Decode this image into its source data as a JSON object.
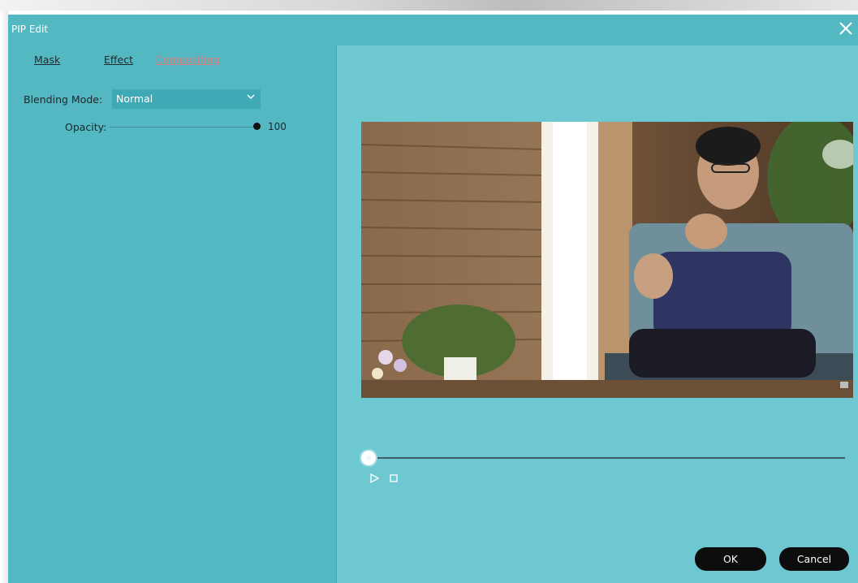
{
  "window": {
    "title": "PIP Edit"
  },
  "tabs": [
    {
      "label": "Mask",
      "active": false
    },
    {
      "label": "Effect",
      "active": false
    },
    {
      "label": "Compositing",
      "active": true
    }
  ],
  "blending": {
    "label": "Blending Mode:",
    "value": "Normal"
  },
  "opacity": {
    "label": "Opacity:",
    "value": "100",
    "level": 1.0
  },
  "preview": {
    "playhead_position": 0.0
  },
  "buttons": {
    "ok": "OK",
    "cancel": "Cancel"
  },
  "colors": {
    "dialog_bg": "#54b8c3",
    "preview_bg": "#6ec8d1",
    "active_tab": "#d97b7b",
    "button_bg": "#0d0d0d"
  },
  "icons": [
    "close-icon",
    "chevron-down-icon",
    "play-icon",
    "stop-icon"
  ]
}
